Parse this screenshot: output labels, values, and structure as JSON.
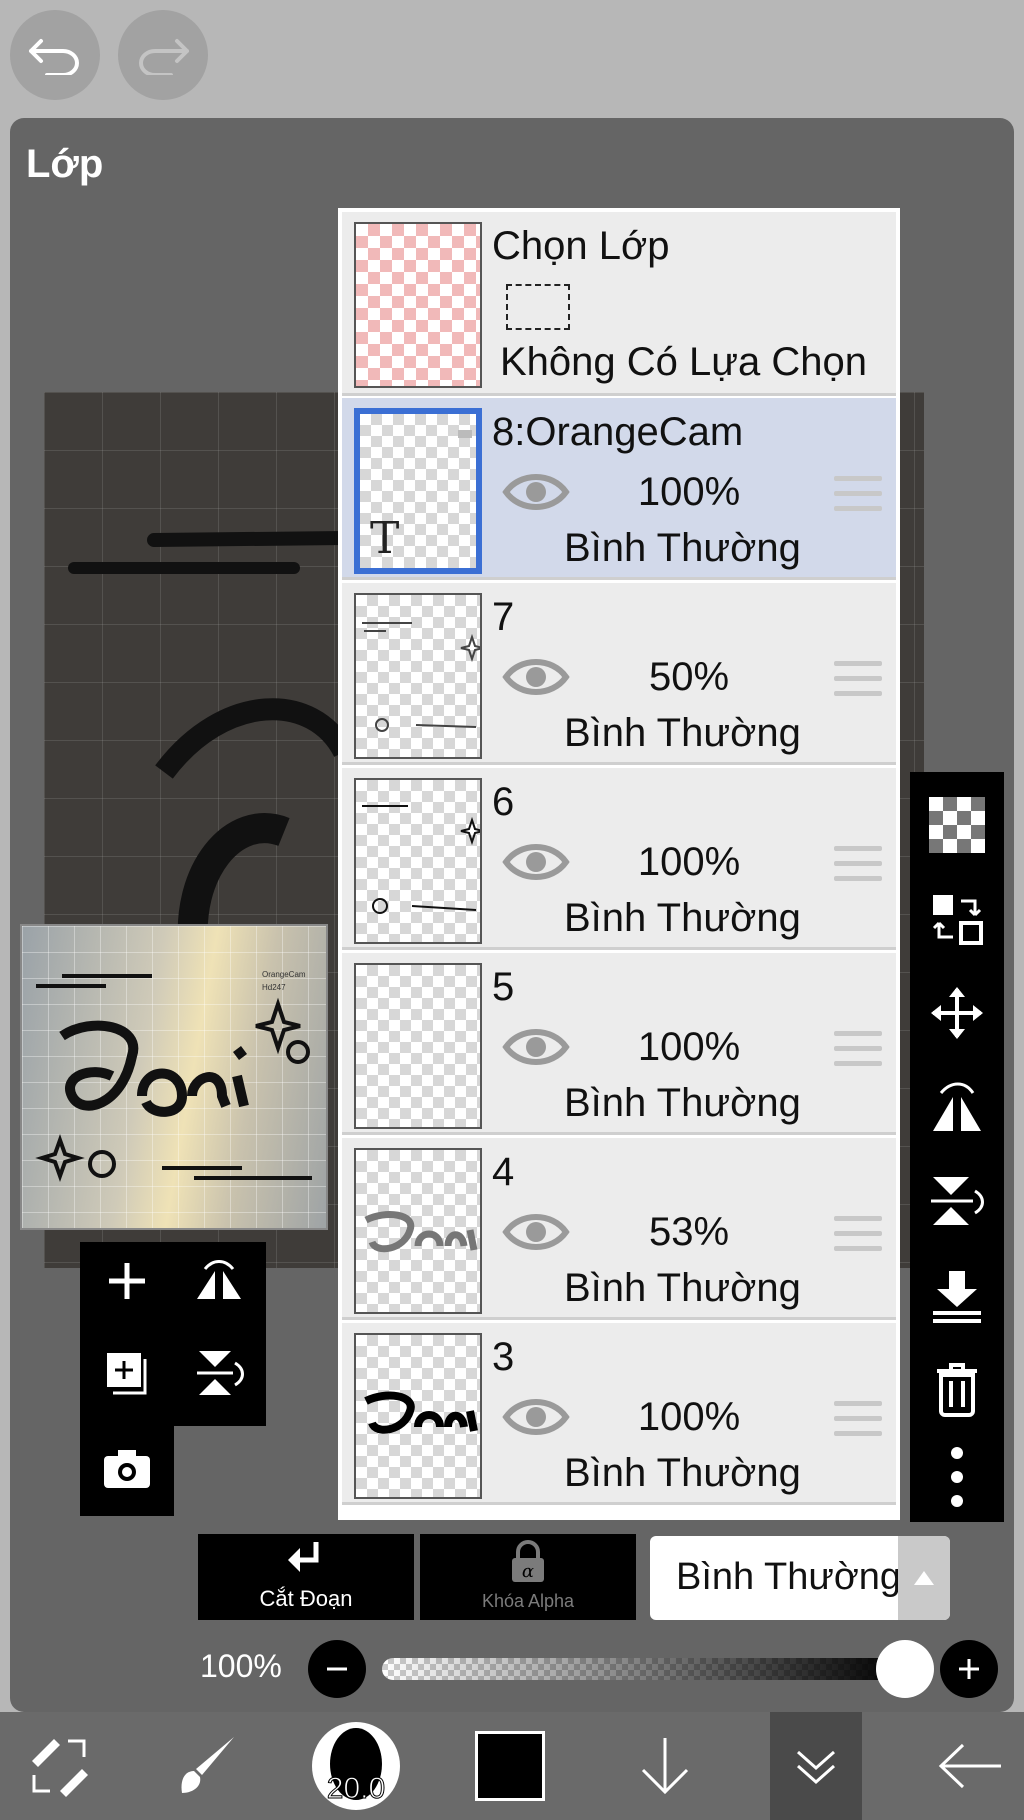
{
  "panel": {
    "title": "Lớp"
  },
  "preview": {
    "watermark_line1": "OrangeCam",
    "watermark_line2": "Hd247"
  },
  "selection_layer": {
    "title": "Chọn Lớp",
    "status": "Không Có Lựa Chọn"
  },
  "layers": [
    {
      "name": "8:OrangeCam",
      "opacity": "100%",
      "blend": "Bình Thường",
      "selected": true,
      "type": "text"
    },
    {
      "name": "7",
      "opacity": "50%",
      "blend": "Bình Thường",
      "selected": false
    },
    {
      "name": "6",
      "opacity": "100%",
      "blend": "Bình Thường",
      "selected": false
    },
    {
      "name": "5",
      "opacity": "100%",
      "blend": "Bình Thường",
      "selected": false
    },
    {
      "name": "4",
      "opacity": "53%",
      "blend": "Bình Thường",
      "selected": false
    },
    {
      "name": "3",
      "opacity": "100%",
      "blend": "Bình Thường",
      "selected": false
    }
  ],
  "bottom_controls": {
    "clip_label": "Cắt Đoạn",
    "alpha_lock_label": "Khóa Alpha",
    "blend_mode": "Bình Thường",
    "opacity_label": "100%",
    "opacity_value": 1.0
  },
  "toolbar": {
    "brush_size": "20.0",
    "color": "#000000"
  },
  "icons": {
    "left_tools": [
      "add-layer-icon",
      "flip-horizontal-icon",
      "duplicate-layer-icon",
      "flip-vertical-icon",
      "camera-icon"
    ],
    "right_tools": [
      "checker-icon",
      "transfer-icon",
      "move-icon",
      "flip-horizontal-icon",
      "flip-vertical-icon",
      "merge-down-icon",
      "trash-icon",
      "more-icon"
    ]
  },
  "colors": {
    "selected_border": "#3b6fd4",
    "selected_row": "#d2d9ea"
  }
}
